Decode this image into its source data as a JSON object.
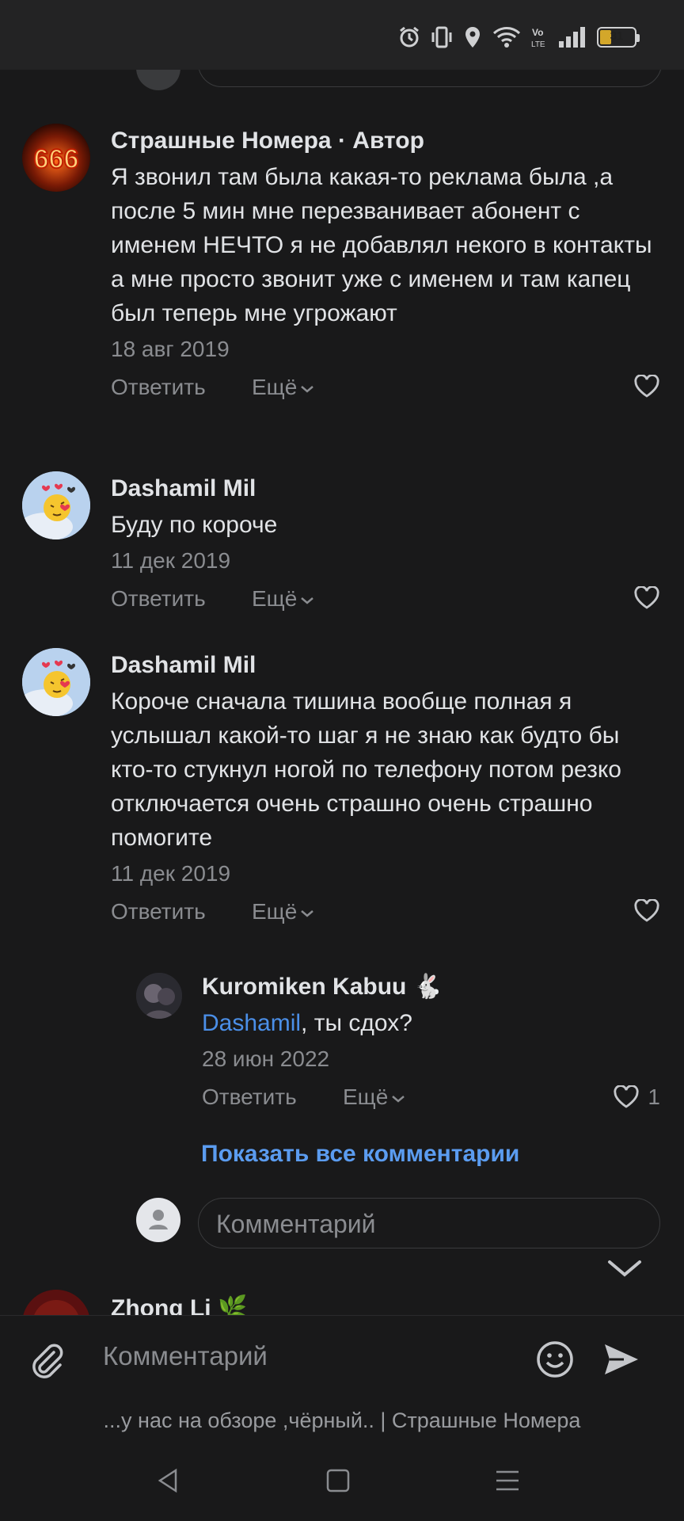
{
  "status_bar": {
    "battery": "31"
  },
  "comments": [
    {
      "author": "Страшные Номера · Автор",
      "text": "Я звонил там была какая-то реклама была ,а после 5 мин мне перезванивает абонент с именем НЕЧТО я не добавлял некого в контакты а мне просто звонит уже с именем и там капец был теперь мне угрожают",
      "date": "18 авг 2019",
      "reply": "Ответить",
      "more": "Ещё",
      "avatar_text": "666"
    },
    {
      "author": "Dashamil Mil",
      "text": "Буду по короче",
      "date": "11 дек 2019",
      "reply": "Ответить",
      "more": "Ещё"
    },
    {
      "author": "Dashamil Mil",
      "text": "Короче сначала тишина вообще полная я услышал какой-то шаг я не знаю как будто бы кто-то стукнул ногой по телефону потом резко отключается очень страшно очень страшно помогите",
      "date": "11 дек 2019",
      "reply": "Ответить",
      "more": "Ещё"
    }
  ],
  "nested_reply": {
    "author": "Kuromiken Kabuu",
    "mention": "Dashamil",
    "text": ", ты сдох?",
    "date": "28 июн 2022",
    "reply": "Ответить",
    "more": "Ещё",
    "likes": "1"
  },
  "show_all": "Показать все комментарии",
  "reply_placeholder": "Комментарий",
  "next_author": "Zhong Li",
  "bottom_input": {
    "placeholder": "Комментарий"
  },
  "caption": "...у нас на обзоре ,чёрный.. | Страшные Номера",
  "colors": {
    "background": "#19191a",
    "link": "#5b9cf0",
    "secondary_text": "#8a8c90"
  }
}
